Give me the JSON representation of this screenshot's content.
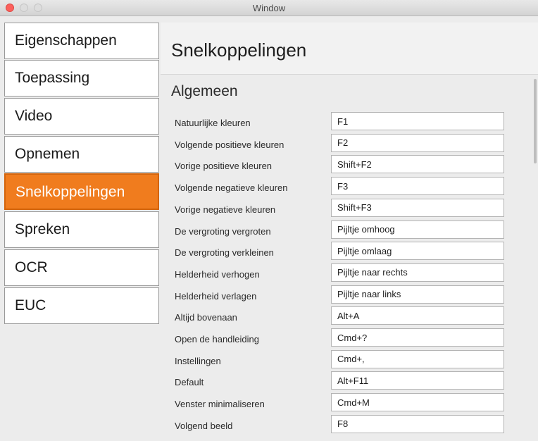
{
  "window": {
    "title": "Window"
  },
  "sidebar": {
    "items": [
      {
        "label": "Eigenschappen",
        "id": "eigenschappen",
        "active": false
      },
      {
        "label": "Toepassing",
        "id": "toepassing",
        "active": false
      },
      {
        "label": "Video",
        "id": "video",
        "active": false
      },
      {
        "label": "Opnemen",
        "id": "opnemen",
        "active": false
      },
      {
        "label": "Snelkoppelingen",
        "id": "snelkoppelingen",
        "active": true
      },
      {
        "label": "Spreken",
        "id": "spreken",
        "active": false
      },
      {
        "label": "OCR",
        "id": "ocr",
        "active": false
      },
      {
        "label": "EUC",
        "id": "euc",
        "active": false
      }
    ]
  },
  "main": {
    "title": "Snelkoppelingen",
    "section": "Algemeen",
    "shortcuts": [
      {
        "label": "Natuurlijke kleuren",
        "value": "F1"
      },
      {
        "label": "Volgende positieve kleuren",
        "value": "F2"
      },
      {
        "label": "Vorige positieve kleuren",
        "value": "Shift+F2"
      },
      {
        "label": "Volgende negatieve kleuren",
        "value": "F3"
      },
      {
        "label": "Vorige negatieve kleuren",
        "value": "Shift+F3"
      },
      {
        "label": "De vergroting vergroten",
        "value": "Pijltje omhoog"
      },
      {
        "label": "De vergroting verkleinen",
        "value": "Pijltje omlaag"
      },
      {
        "label": "Helderheid verhogen",
        "value": "Pijltje naar rechts"
      },
      {
        "label": "Helderheid verlagen",
        "value": "Pijltje naar links"
      },
      {
        "label": "Altijd bovenaan",
        "value": "Alt+A"
      },
      {
        "label": "Open de handleiding",
        "value": "Cmd+?"
      },
      {
        "label": "Instellingen",
        "value": "Cmd+,"
      },
      {
        "label": "Default",
        "value": "Alt+F11"
      },
      {
        "label": "Venster minimaliseren",
        "value": "Cmd+M"
      },
      {
        "label": "Volgend beeld",
        "value": "F8"
      }
    ]
  },
  "colors": {
    "accent": "#f07c1e",
    "accent_border": "#d2640c"
  }
}
